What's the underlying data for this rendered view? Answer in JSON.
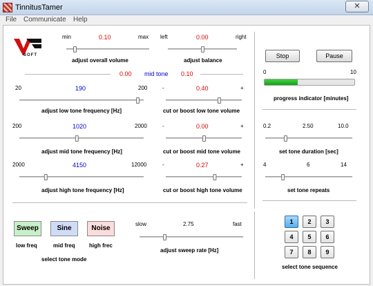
{
  "window": {
    "title": "TinnitusTamer",
    "close_glyph": "✕"
  },
  "menu": [
    "File",
    "Communicate",
    "Help"
  ],
  "logo": {
    "text": "SOFT"
  },
  "volume": {
    "min": "min",
    "value": "0.10",
    "max": "max",
    "label": "adjust overall volume",
    "level": 0.1
  },
  "balance": {
    "left": "left",
    "value": "0.00",
    "right": "right",
    "label": "adjust balance",
    "level": 0.5
  },
  "midtone": {
    "left_value": "0.00",
    "label": "mid tone",
    "right_value": "0.10"
  },
  "low_freq": {
    "min": "20",
    "value": "190",
    "max": "200",
    "label": "adjust low tone frequency [Hz]",
    "level": 0.95
  },
  "low_vol": {
    "minus": "-",
    "value": "0.40",
    "plus": "+",
    "label": "cut or boost low tone volume",
    "level": 0.7
  },
  "mid_freq": {
    "min": "200",
    "value": "1020",
    "max": "2000",
    "label": "adjust mid tone frequency [Hz]",
    "level": 0.46
  },
  "mid_vol": {
    "minus": "-",
    "value": "0.00",
    "plus": "+",
    "label": "cut or boost mid tone volume",
    "level": 0.5
  },
  "high_freq": {
    "min": "2000",
    "value": "4150",
    "max": "12000",
    "label": "adjust high tone frequency [Hz]",
    "level": 0.21
  },
  "high_vol": {
    "minus": "-",
    "value": "0.27",
    "plus": "+",
    "label": "cut or boost high tone volume",
    "level": 0.64
  },
  "controls": {
    "stop": "Stop",
    "pause": "Pause"
  },
  "progress": {
    "min": "0",
    "max": "10",
    "label": "progress indicator [minutes]",
    "fraction": 0.37
  },
  "duration": {
    "min": "0.2",
    "value": "2.50",
    "max": "10.0",
    "label": "set tone duration [sec]",
    "level": 0.23
  },
  "repeats": {
    "min": "4",
    "value": "6",
    "max": "14",
    "label": "set tone repeats",
    "level": 0.2
  },
  "modes": {
    "sweep": "Sweep",
    "sine": "Sine",
    "noise": "Noise",
    "sweep_sub": "low freq",
    "sine_sub": "mid freq",
    "noise_sub": "high frec",
    "label": "select tone mode",
    "colors": {
      "sweep": "#c8f0c8",
      "sine": "#d0dcf7",
      "noise": "#fbdcdc"
    }
  },
  "sweep_rate": {
    "slow": "slow",
    "value": "2.75",
    "fast": "fast",
    "label": "adjust sweep rate [Hz]",
    "level": 0.24
  },
  "sequence": {
    "buttons": [
      "1",
      "2",
      "3",
      "4",
      "5",
      "6",
      "7",
      "8",
      "9"
    ],
    "active": "1",
    "label": "select tone sequence"
  }
}
